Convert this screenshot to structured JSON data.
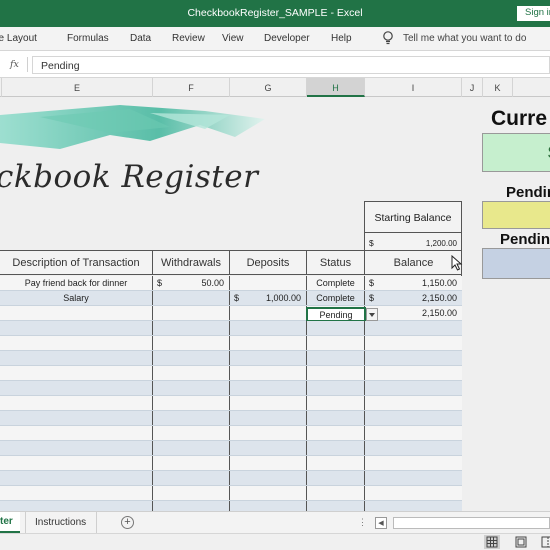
{
  "window": {
    "title": "CheckbookRegister_SAMPLE  -  Excel",
    "signin": "Sign in"
  },
  "ribbon": {
    "tabs": [
      "ge Layout",
      "Formulas",
      "Data",
      "Review",
      "View",
      "Developer",
      "Help"
    ],
    "tell_me": "Tell me what you want to do"
  },
  "formula_bar": {
    "fx": "fx",
    "value": "Pending"
  },
  "columns": [
    "E",
    "F",
    "G",
    "H",
    "I",
    "J",
    "K"
  ],
  "selected_column": "H",
  "sheet": {
    "title": "ckbook Register",
    "starting_balance": {
      "label": "Starting Balance",
      "currency": "$",
      "amount": "1,200.00"
    },
    "headers": [
      "Description of Transaction",
      "Withdrawals",
      "Deposits",
      "Status",
      "Balance"
    ],
    "rows": [
      {
        "description": "Pay friend back for dinner",
        "withdrawal_cur": "$",
        "withdrawal": "50.00",
        "deposit_cur": "",
        "deposit": "",
        "status": "Complete",
        "balance_cur": "$",
        "balance": "1,150.00"
      },
      {
        "description": "Salary",
        "withdrawal_cur": "",
        "withdrawal": "",
        "deposit_cur": "$",
        "deposit": "1,000.00",
        "status": "Complete",
        "balance_cur": "$",
        "balance": "2,150.00"
      },
      {
        "description": "",
        "withdrawal_cur": "",
        "withdrawal": "",
        "deposit_cur": "",
        "deposit": "",
        "status": "Pending",
        "balance_cur": "",
        "balance": "2,150.00"
      }
    ],
    "empty_rows": 17
  },
  "summary": {
    "current_label": "Curre",
    "current_value_fragment": "$",
    "pending1": "Pendin",
    "pending2": "Pendin"
  },
  "sheet_tabs": {
    "active": "ter",
    "other": "Instructions",
    "add": "+"
  },
  "icons": [
    "lightbulb-icon",
    "dropdown-arrow-icon",
    "mouse-cursor-icon",
    "add-sheet-icon",
    "scroll-left-icon",
    "normal-view-icon",
    "page-layout-icon",
    "page-break-icon"
  ],
  "colors": {
    "excel_green": "#217346",
    "row_even": "#dde4ec",
    "box_green": "#c6efce",
    "box_yellow": "#e8e88c",
    "box_blue": "#c5d1e3"
  }
}
